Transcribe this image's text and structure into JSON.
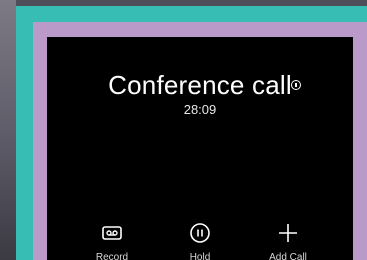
{
  "call": {
    "title": "Conference call",
    "duration": "28:09"
  },
  "controls": [
    {
      "label": "Record",
      "icon": "tape-icon"
    },
    {
      "label": "Hold",
      "icon": "pause-circle-icon"
    },
    {
      "label": "Add Call",
      "icon": "plus-icon"
    }
  ],
  "colors": {
    "outer_border": "#37bdb4",
    "inner_border": "#b99ac8",
    "screen_background": "#000000",
    "text": "#ffffff"
  }
}
